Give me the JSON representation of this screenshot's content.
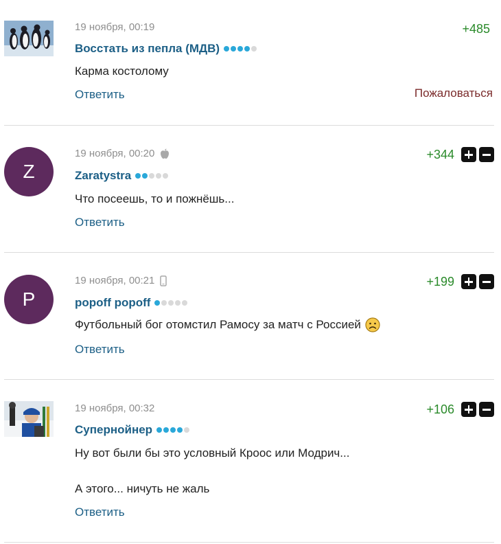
{
  "comments": [
    {
      "date": "19 ноября, 00:19",
      "device_icon": "none",
      "author": "Восстать из пепла (МДВ)",
      "rank_dots": [
        1,
        1,
        1,
        1,
        0
      ],
      "score": "+485",
      "text_lines": [
        "Карма костоломy"
      ],
      "reply_label": "Ответить",
      "report_label": "Пожаловаться",
      "avatar_icon": "penguins-photo-icon"
    },
    {
      "date": "19 ноября, 00:20",
      "device_icon": "apple-icon",
      "author": "Zaratystra",
      "rank_dots": [
        1,
        1,
        0,
        0,
        0
      ],
      "score": "+344",
      "text_lines": [
        "Что посеешь, то и пожнёшь..."
      ],
      "reply_label": "Ответить",
      "avatar_letter": "Z"
    },
    {
      "date": "19 ноября, 00:21",
      "device_icon": "mobile-phone-icon",
      "author": "popoff popoff",
      "rank_dots": [
        1,
        0,
        0,
        0,
        0
      ],
      "score": "+199",
      "text_lines": [
        "Футбольный бог отомстил Рамосу за матч с Россией"
      ],
      "emoji_icon": "sad-face-icon",
      "reply_label": "Ответить",
      "avatar_letter": "P"
    },
    {
      "date": "19 ноября, 00:32",
      "device_icon": "none",
      "author": "Супернойнер",
      "rank_dots": [
        1,
        1,
        1,
        1,
        0
      ],
      "score": "+106",
      "text_lines": [
        "Ну вот были бы это условный Кроос или Модрич...",
        "А этого... ничуть не жаль"
      ],
      "reply_label": "Ответить",
      "avatar_icon": "biathlon-photo-icon"
    }
  ],
  "colors": {
    "author": "#1c5f86",
    "score": "#2a8a2a",
    "report": "#7a2a2a",
    "dot_on": "#2aa8d9",
    "avatar_bg": "#5d2a5d"
  }
}
